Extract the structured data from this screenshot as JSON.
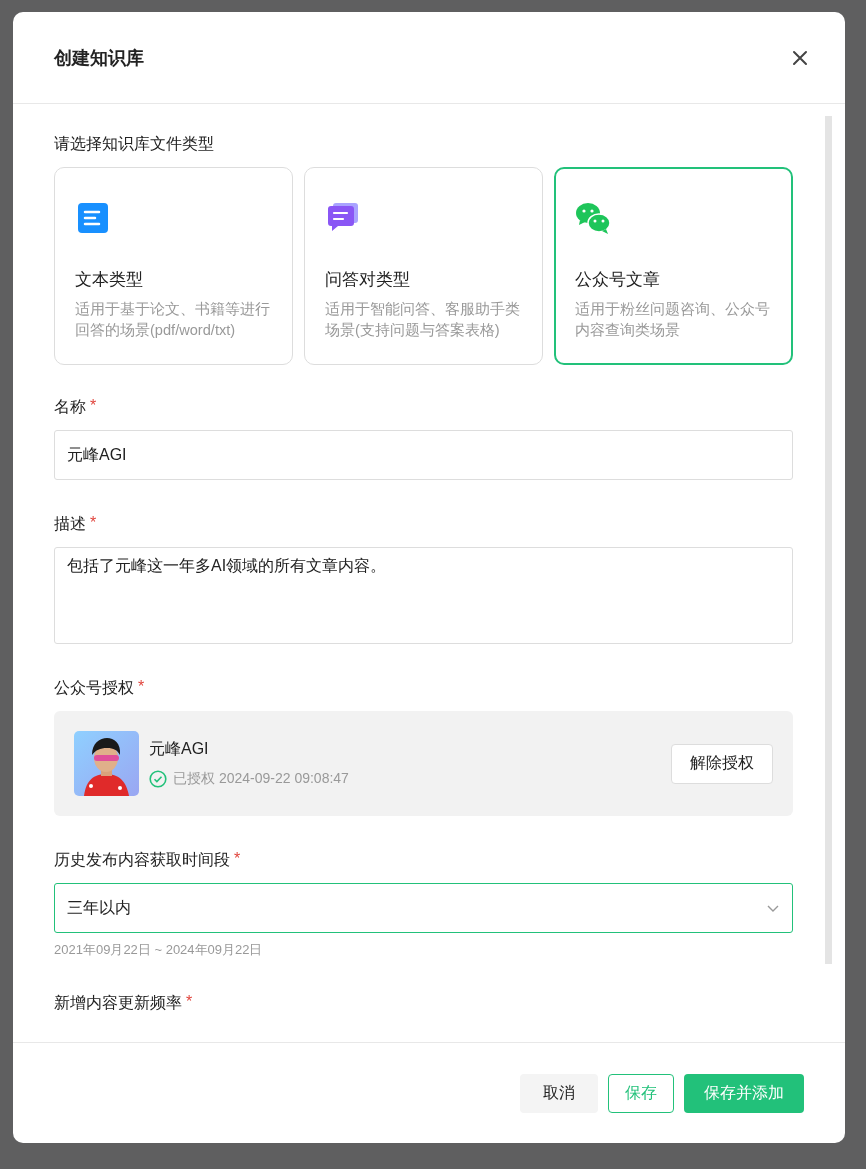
{
  "dialog": {
    "title": "创建知识库"
  },
  "type_section": {
    "label": "请选择知识库文件类型",
    "options": [
      {
        "kind": "text",
        "title": "文本类型",
        "description": "适用于基于论文、书籍等进行回答的场景(pdf/word/txt)",
        "selected": false
      },
      {
        "kind": "qa",
        "title": "问答对类型",
        "description": "适用于智能问答、客服助手类场景(支持问题与答案表格)",
        "selected": false
      },
      {
        "kind": "wechat",
        "title": "公众号文章",
        "description": "适用于粉丝问题咨询、公众号内容查询类场景",
        "selected": true
      }
    ]
  },
  "fields": [
    {
      "kind": "input",
      "label": "名称",
      "required_mark": "*",
      "value": "元峰AGI"
    },
    {
      "kind": "textarea",
      "label": "描述",
      "required_mark": "*",
      "value": "包括了元峰这一年多AI领域的所有文章内容。"
    },
    {
      "kind": "account",
      "label": "公众号授权",
      "required_mark": "*",
      "account": {
        "name": "元峰AGI",
        "status": "已授权 2024-09-22 09:08:47",
        "authorized": true,
        "action": "解除授权"
      }
    },
    {
      "kind": "select",
      "label": "历史发布内容获取时间段",
      "required_mark": "*",
      "value": "三年以内",
      "focused": true,
      "hint": "2021年09月22日 ~ 2024年09月22日"
    },
    {
      "kind": "partial",
      "label": "新增内容更新频率",
      "required_mark": "*"
    }
  ],
  "buttons": [
    {
      "kind": "default",
      "label": "取消"
    },
    {
      "kind": "outline",
      "label": "保存"
    },
    {
      "kind": "primary",
      "label": "保存并添加"
    }
  ]
}
